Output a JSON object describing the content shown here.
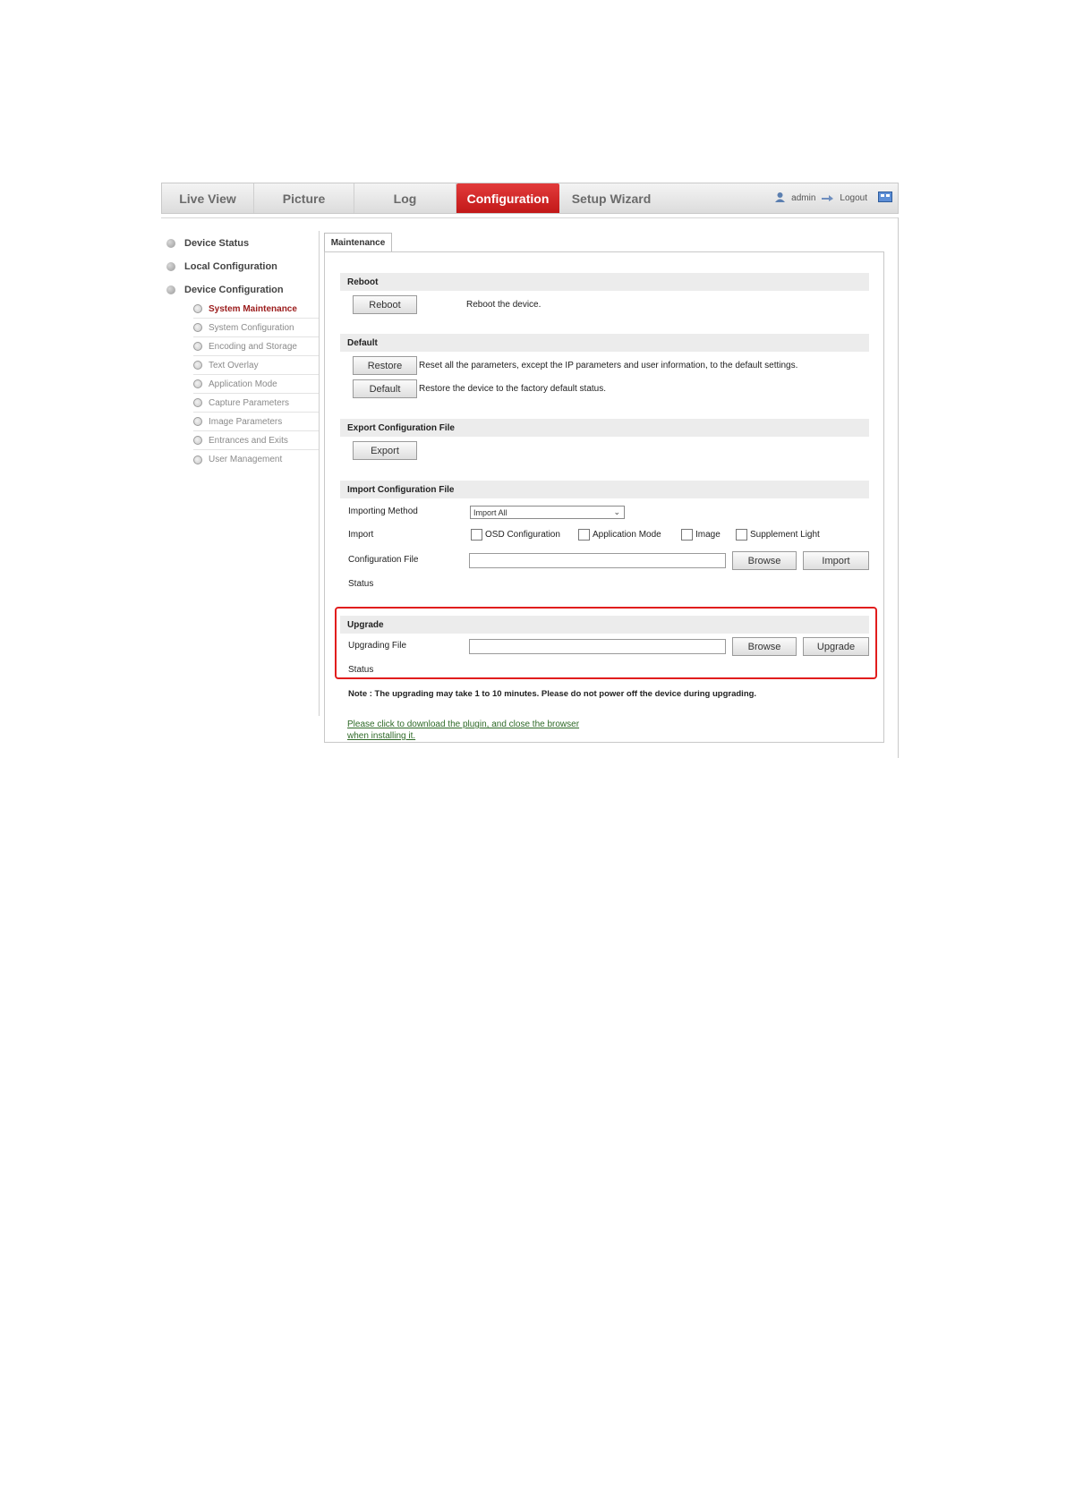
{
  "nav": {
    "tabs": [
      {
        "label": "Live View"
      },
      {
        "label": "Picture"
      },
      {
        "label": "Log"
      },
      {
        "label": "Configuration"
      },
      {
        "label": "Setup Wizard"
      }
    ],
    "user": "admin",
    "logout": "Logout",
    "accent_color": "#d42626"
  },
  "sidebar": {
    "items": [
      {
        "label": "Device Status"
      },
      {
        "label": "Local Configuration"
      },
      {
        "label": "Device Configuration"
      }
    ],
    "subitems": [
      {
        "label": "System Maintenance"
      },
      {
        "label": "System Configuration"
      },
      {
        "label": "Encoding and Storage"
      },
      {
        "label": "Text Overlay"
      },
      {
        "label": "Application Mode"
      },
      {
        "label": "Capture Parameters"
      },
      {
        "label": "Image Parameters"
      },
      {
        "label": "Entrances and Exits"
      },
      {
        "label": "User Management"
      }
    ]
  },
  "main": {
    "tab_label": "Maintenance",
    "reboot": {
      "title": "Reboot",
      "button": "Reboot",
      "desc": "Reboot the device."
    },
    "default": {
      "title": "Default",
      "restore_button": "Restore",
      "restore_desc": "Reset all the parameters, except the IP parameters and user information, to the default settings.",
      "default_button": "Default",
      "default_desc": "Restore the device to the factory default status."
    },
    "export": {
      "title": "Export Configuration File",
      "button": "Export"
    },
    "import": {
      "title": "Import Configuration File",
      "method_label": "Importing Method",
      "method_value": "Import All",
      "import_label": "Import",
      "options": [
        "OSD Configuration",
        "Application Mode",
        "Image",
        "Supplement Light"
      ],
      "file_label": "Configuration File",
      "browse_button": "Browse",
      "import_button": "Import",
      "status_label": "Status"
    },
    "upgrade": {
      "title": "Upgrade",
      "file_label": "Upgrading File",
      "browse_button": "Browse",
      "upgrade_button": "Upgrade",
      "status_label": "Status",
      "highlight_color": "#e11d1d"
    },
    "note": "Note :  The upgrading may take 1 to 10 minutes. Please do not power off the device during upgrading.",
    "plugin_link_line1": "Please click to download the plugin, and close the browser",
    "plugin_link_line2": "when installing it."
  }
}
